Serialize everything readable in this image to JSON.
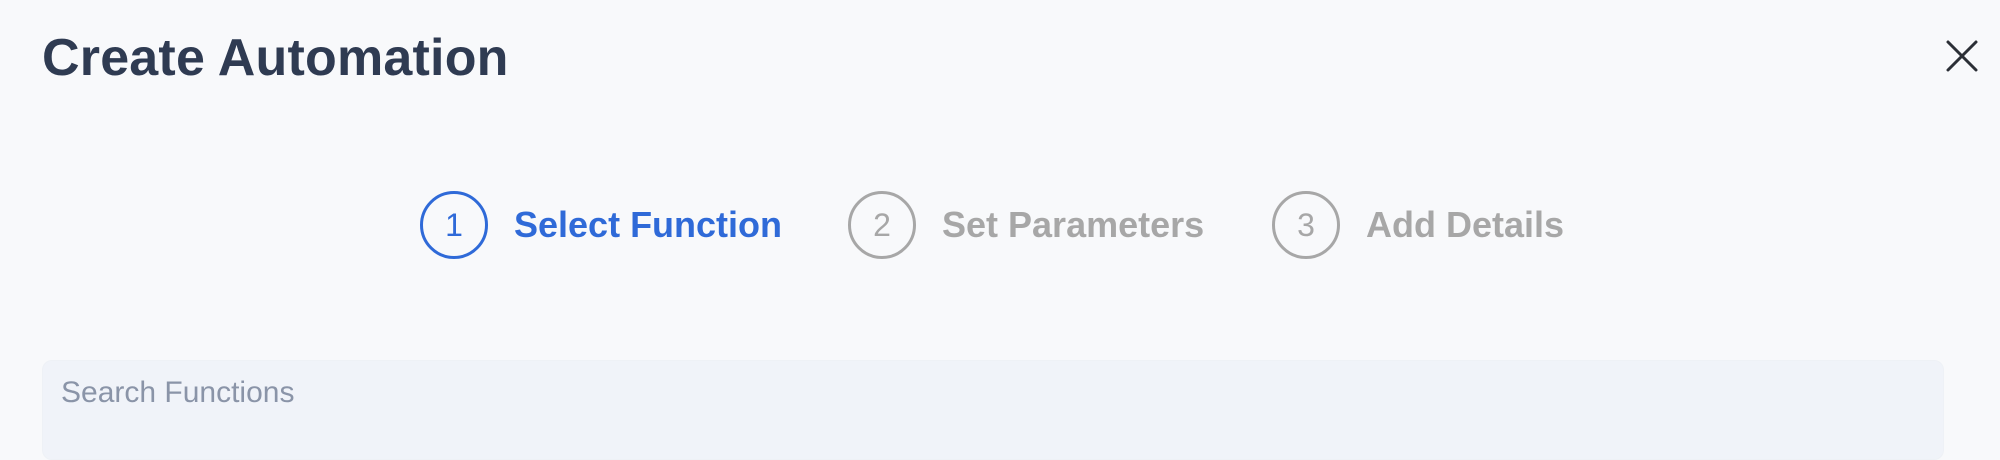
{
  "modal": {
    "title": "Create Automation"
  },
  "stepper": {
    "steps": [
      {
        "number": "1",
        "label": "Select Function",
        "active": true
      },
      {
        "number": "2",
        "label": "Set Parameters",
        "active": false
      },
      {
        "number": "3",
        "label": "Add Details",
        "active": false
      }
    ]
  },
  "search": {
    "placeholder": "Search Functions",
    "value": ""
  },
  "icons": {
    "close": "close-icon"
  },
  "colors": {
    "accent": "#2f6ad8",
    "inactive": "#a7a7a7",
    "title": "#2f3b52",
    "background": "#f8f9fb",
    "search_bg": "#f0f3f9"
  }
}
